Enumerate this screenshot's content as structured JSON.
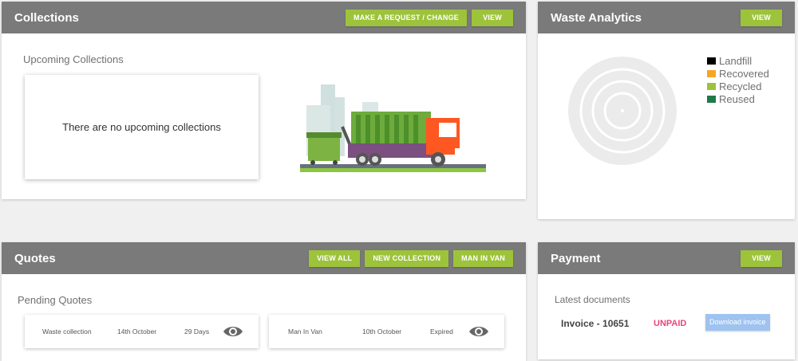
{
  "collections": {
    "title": "Collections",
    "request_button": "Make a request / change",
    "view_button": "View",
    "upcoming_label": "Upcoming Collections",
    "empty_message": "There are no upcoming collections"
  },
  "analytics": {
    "title": "Waste Analytics",
    "view_button": "View",
    "legend": [
      {
        "label": "Landfill",
        "color": "#000000"
      },
      {
        "label": "Recovered",
        "color": "#f5a623"
      },
      {
        "label": "Recycled",
        "color": "#9dc33b"
      },
      {
        "label": "Reused",
        "color": "#1e7a4a"
      }
    ]
  },
  "quotes": {
    "title": "Quotes",
    "view_all_button": "View all",
    "new_collection_button": "New collection",
    "man_in_van_button": "Man in van",
    "pending_label": "Pending Quotes",
    "items": [
      {
        "service": "Waste collection",
        "date": "14th October",
        "status": "29 Days"
      },
      {
        "service": "Man In Van",
        "date": "10th October",
        "status": "Expired"
      }
    ]
  },
  "payment": {
    "title": "Payment",
    "view_button": "View",
    "latest_label": "Latest documents",
    "invoice": "Invoice - 10651",
    "invoice_status": "UNPAID",
    "download_button": "Download invoice"
  },
  "colors": {
    "header": "#7a7a7a",
    "accent": "#9dc33b",
    "unpaid": "#e8457f",
    "download": "#9fc3f0"
  }
}
